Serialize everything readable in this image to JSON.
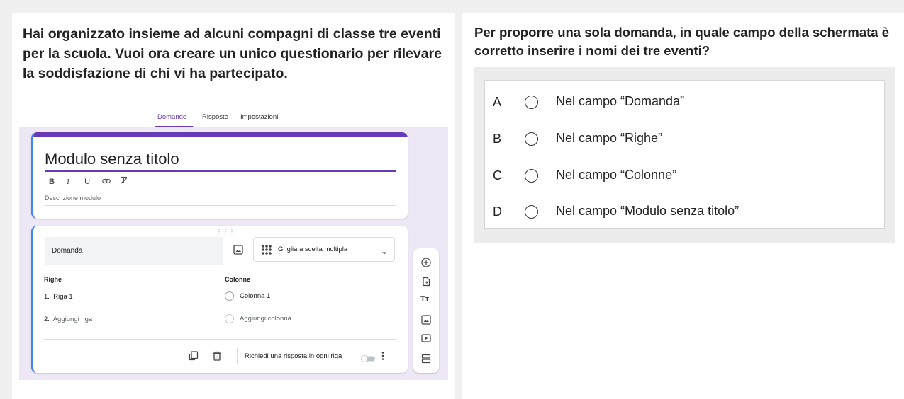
{
  "left": {
    "stem": "Hai organizzato insieme ad alcuni compagni di classe tre eventi per la scuola. Vuoi ora creare un unico questionario per rilevare la soddisfazione di chi vi ha partecipato."
  },
  "form": {
    "tabs": [
      "Domande",
      "Risposte",
      "Impostazioni"
    ],
    "active_tab": "Domande",
    "title": "Modulo senza titolo",
    "format_buttons": [
      "B",
      "I",
      "U",
      "link",
      "clear-format"
    ],
    "description_placeholder": "Descrizione modulo",
    "question_placeholder": "Domanda",
    "question_type": "Griglia a scelta multipla",
    "rows_header": "Righe",
    "columns_header": "Colonne",
    "rows": [
      {
        "num": "1.",
        "label": "Riga 1"
      }
    ],
    "add_row": {
      "num": "2.",
      "label": "Aggiungi riga"
    },
    "columns": [
      "Colonna 1"
    ],
    "add_column": "Aggiungi colonna",
    "required_label": "Richiedi una risposta in ogni riga",
    "required_on": false,
    "side_toolbar": [
      "add-question-icon",
      "import-questions-icon",
      "add-title-icon",
      "add-image-icon",
      "add-video-icon",
      "add-section-icon"
    ],
    "accent_color": "#673ab7",
    "background_color": "#ede7f6"
  },
  "right": {
    "stem": "Per proporre una sola domanda, in quale campo della schermata è corretto inserire i nomi dei tre eventi?",
    "options": [
      {
        "letter": "A",
        "text": "Nel campo “Domanda”"
      },
      {
        "letter": "B",
        "text": "Nel campo “Righe”"
      },
      {
        "letter": "C",
        "text": "Nel campo “Colonne”"
      },
      {
        "letter": "D",
        "text": "Nel campo “Modulo senza titolo”"
      }
    ]
  }
}
